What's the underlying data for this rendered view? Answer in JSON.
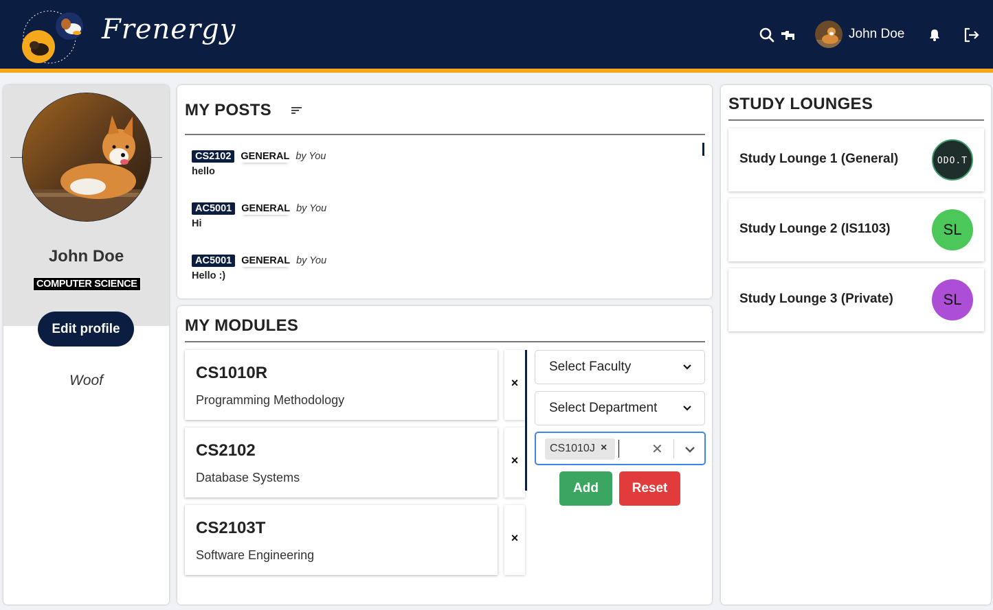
{
  "navbar": {
    "brand": "Frenergy",
    "user_name": "John Doe",
    "colors": {
      "background": "#0b1d40",
      "accent_border": "#f6a81d"
    },
    "icons": [
      "search-icon",
      "dog-icon",
      "bell-icon",
      "logout-icon"
    ]
  },
  "profile": {
    "name": "John Doe",
    "faculty": "COMPUTER SCIENCE",
    "edit_label": "Edit profile",
    "bio": "Woof"
  },
  "posts": {
    "title": "MY POSTS",
    "by_label": "by You",
    "items": [
      {
        "module": "CS2102",
        "category": "GENERAL",
        "body": "hello"
      },
      {
        "module": "AC5001",
        "category": "GENERAL",
        "body": "Hi"
      },
      {
        "module": "AC5001",
        "category": "GENERAL",
        "body": "Hello :)"
      }
    ]
  },
  "modules": {
    "title": "MY MODULES",
    "remove_label": "×",
    "items": [
      {
        "code": "CS1010R",
        "name": "Programming Methodology"
      },
      {
        "code": "CS2102",
        "name": "Database Systems"
      },
      {
        "code": "CS2103T",
        "name": "Software Engineering"
      }
    ],
    "faculty_select": "Select Faculty",
    "department_select": "Select Department",
    "selected_chip": "CS1010J",
    "chip_remove": "×",
    "clear": "✕",
    "add_label": "Add",
    "reset_label": "Reset",
    "colors": {
      "add": "#3aa661",
      "reset": "#e23b3b"
    }
  },
  "lounges": {
    "title": "STUDY LOUNGES",
    "items": [
      {
        "name": "Study Lounge 1 (General)",
        "avatar": "ODO.T",
        "color": "#1e2e2a"
      },
      {
        "name": "Study Lounge 2 (IS1103)",
        "avatar": "SL",
        "color": "#4cc75a"
      },
      {
        "name": "Study Lounge 3 (Private)",
        "avatar": "SL",
        "color": "#ad4fd6"
      }
    ]
  }
}
